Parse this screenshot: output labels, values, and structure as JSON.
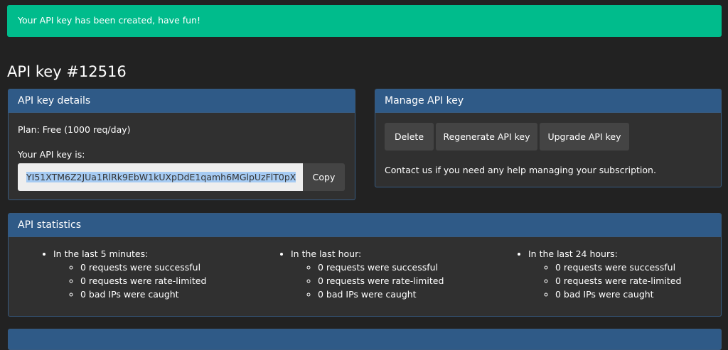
{
  "alert": {
    "message": "Your API key has been created, have fun!",
    "color": "#00bc8c"
  },
  "page_title": "API key #12516",
  "details": {
    "title": "API key details",
    "plan": "Plan: Free (1000 req/day)",
    "key_label": "Your API key is:",
    "key_value": "YI51XTM6Z2JUa1RlRk9EbW1kUXpDdE1qamh6MGlpUzFlT0pX",
    "copy_label": "Copy"
  },
  "manage": {
    "title": "Manage API key",
    "buttons": [
      "Delete",
      "Regenerate API key",
      "Upgrade API key"
    ],
    "note": "Contact us if you need any help managing your subscription."
  },
  "stats": {
    "title": "API statistics",
    "periods": [
      {
        "label": "In the last 5 minutes:",
        "items": [
          "0 requests were successful",
          "0 requests were rate-limited",
          "0 bad IPs were caught"
        ]
      },
      {
        "label": "In the last hour:",
        "items": [
          "0 requests were successful",
          "0 requests were rate-limited",
          "0 bad IPs were caught"
        ]
      },
      {
        "label": "In the last 24 hours:",
        "items": [
          "0 requests were successful",
          "0 requests were rate-limited",
          "0 bad IPs were caught"
        ]
      }
    ]
  }
}
